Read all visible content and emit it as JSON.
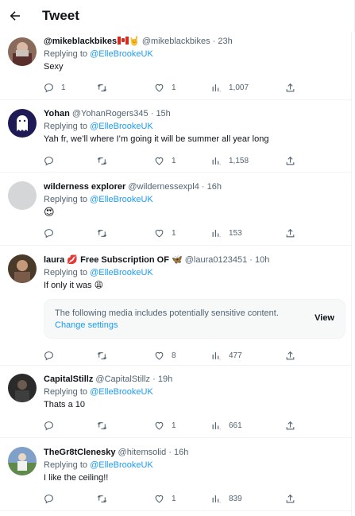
{
  "header": {
    "title": "Tweet"
  },
  "tweets": [
    {
      "name": "@mikeblackbikes",
      "name_emoji": "🤘",
      "handle": "@mikeblackbikes",
      "time": "23h",
      "replying_prefix": "Replying to ",
      "replying_to": "@ElleBrookeUK",
      "text": "Sexy",
      "replies": "1",
      "retweets": "",
      "likes": "1",
      "views": "1,007"
    },
    {
      "name": "Yohan",
      "handle": "@YohanRogers345",
      "time": "15h",
      "replying_prefix": "Replying to ",
      "replying_to": "@ElleBrookeUK",
      "text": "Yah fr, we’ll where I’m going it will be summer all year long",
      "replies": "",
      "retweets": "",
      "likes": "1",
      "views": "1,158"
    },
    {
      "name": "wilderness explorer",
      "handle": "@wildernessexpl4",
      "time": "16h",
      "replying_prefix": "Replying to ",
      "replying_to": "@ElleBrookeUK",
      "text": "😍",
      "replies": "",
      "retweets": "",
      "likes": "1",
      "views": "153"
    },
    {
      "name": "laura 💋 Free Subscription OF 🦋",
      "handle": "@laura0123451",
      "time": "10h",
      "replying_prefix": "Replying to ",
      "replying_to": "@ElleBrookeUK",
      "text": "If only it was 😩",
      "sensitive_text": "The following media includes potentially sensitive content.",
      "sensitive_link": "Change settings",
      "sensitive_view": "View",
      "replies": "",
      "retweets": "",
      "likes": "8",
      "views": "477"
    },
    {
      "name": "CapitalStillz",
      "handle": "@CapitalStillz",
      "time": "19h",
      "replying_prefix": "Replying to ",
      "replying_to": "@ElleBrookeUK",
      "text": "Thats a 10",
      "replies": "",
      "retweets": "",
      "likes": "1",
      "views": "661"
    },
    {
      "name": "TheGr8tClenesky",
      "handle": "@hitemsolid",
      "time": "16h",
      "replying_prefix": "Replying to ",
      "replying_to": "@ElleBrookeUK",
      "text": "I like the ceiling!!",
      "replies": "",
      "retweets": "",
      "likes": "1",
      "views": "839"
    }
  ],
  "separator": "·",
  "icons": {
    "back": "arrow-left-icon",
    "reply": "reply-icon",
    "retweet": "retweet-icon",
    "like": "heart-icon",
    "views": "views-icon",
    "share": "share-icon"
  },
  "colors": {
    "link": "#1d9bf0",
    "muted": "#536471",
    "text": "#0f1419"
  }
}
